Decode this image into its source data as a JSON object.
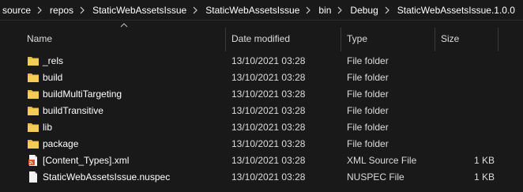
{
  "breadcrumb": [
    "source",
    "repos",
    "StaticWebAssetsIssue",
    "StaticWebAssetsIssue",
    "bin",
    "Debug",
    "StaticWebAssetsIssue.1.0.0"
  ],
  "columns": {
    "name": "Name",
    "date": "Date modified",
    "type": "Type",
    "size": "Size"
  },
  "files": [
    {
      "name": "_rels",
      "date": "13/10/2021 03:28",
      "type": "File folder",
      "size": "",
      "icon": "folder-icon"
    },
    {
      "name": "build",
      "date": "13/10/2021 03:28",
      "type": "File folder",
      "size": "",
      "icon": "folder-icon"
    },
    {
      "name": "buildMultiTargeting",
      "date": "13/10/2021 03:28",
      "type": "File folder",
      "size": "",
      "icon": "folder-icon"
    },
    {
      "name": "buildTransitive",
      "date": "13/10/2021 03:28",
      "type": "File folder",
      "size": "",
      "icon": "folder-icon"
    },
    {
      "name": "lib",
      "date": "13/10/2021 03:28",
      "type": "File folder",
      "size": "",
      "icon": "folder-icon"
    },
    {
      "name": "package",
      "date": "13/10/2021 03:28",
      "type": "File folder",
      "size": "",
      "icon": "folder-icon"
    },
    {
      "name": "[Content_Types].xml",
      "date": "13/10/2021 03:28",
      "type": "XML Source File",
      "size": "1 KB",
      "icon": "xml-file-icon"
    },
    {
      "name": "StaticWebAssetsIssue.nuspec",
      "date": "13/10/2021 03:28",
      "type": "NUSPEC File",
      "size": "1 KB",
      "icon": "document-file-icon"
    }
  ],
  "colors": {
    "background": "#191919",
    "folder": "#e8b93c",
    "text": "#ffffff",
    "header_text": "#dcdcdc"
  }
}
